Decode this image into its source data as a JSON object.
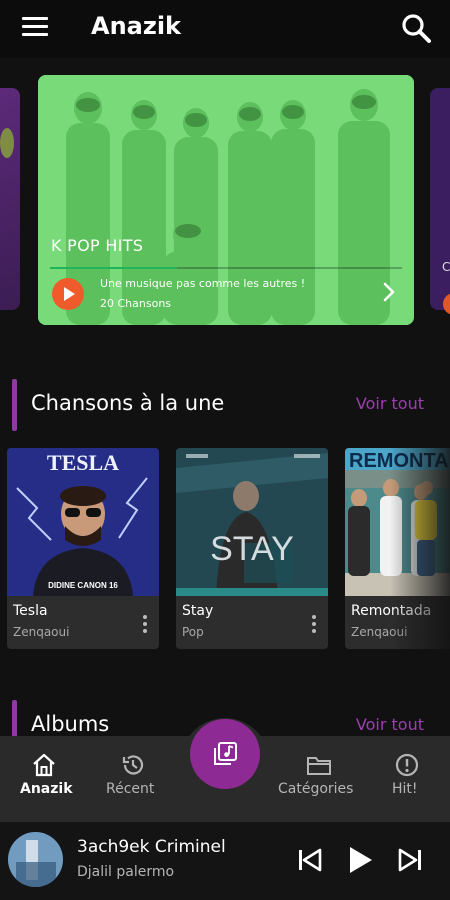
{
  "app": {
    "title": "Anazik"
  },
  "icons": {
    "menu": "menu-icon",
    "search": "search-icon",
    "next": "chevron-right-icon",
    "play": "play-icon",
    "more": "more-vertical-icon"
  },
  "colors": {
    "accent": "#8d2a93",
    "hero_tint": "#7fe07f",
    "play_orange": "#ef5b2b",
    "progress_green": "#1fb35a"
  },
  "featured": {
    "title": "K POP HITS",
    "subtitle": "Une musique pas comme les autres !",
    "count": "20 Chansons",
    "progress": 0.36,
    "page_index": 1,
    "page_count": 5
  },
  "sections": {
    "trending": {
      "title": "Chansons à la une",
      "link": "Voir tout"
    },
    "albums": {
      "title": "Albums",
      "link": "Voir tout"
    }
  },
  "songs": [
    {
      "title": "Tesla",
      "artist": "Zenqaoui",
      "cover_text": "TESLA",
      "cover_caption": "DIDINE CANON 16"
    },
    {
      "title": "Stay",
      "artist": "Pop",
      "cover_text": "STAY"
    },
    {
      "title": "Remontada",
      "artist": "Zenqaoui",
      "cover_text": "REMONTA"
    }
  ],
  "nav": [
    {
      "label": "Anazik",
      "icon": "home-icon",
      "active": true
    },
    {
      "label": "Récent",
      "icon": "history-icon",
      "active": false
    },
    {
      "label": "",
      "icon": "music-library-icon",
      "active": false
    },
    {
      "label": "Catégories",
      "icon": "folder-icon",
      "active": false
    },
    {
      "label": "Hit!",
      "icon": "alert-circle-icon",
      "active": false
    }
  ],
  "player": {
    "title": "3ach9ek Criminel",
    "artist": "Djalil palermo",
    "controls": [
      "skip-previous-icon",
      "play-icon",
      "skip-next-icon"
    ]
  }
}
